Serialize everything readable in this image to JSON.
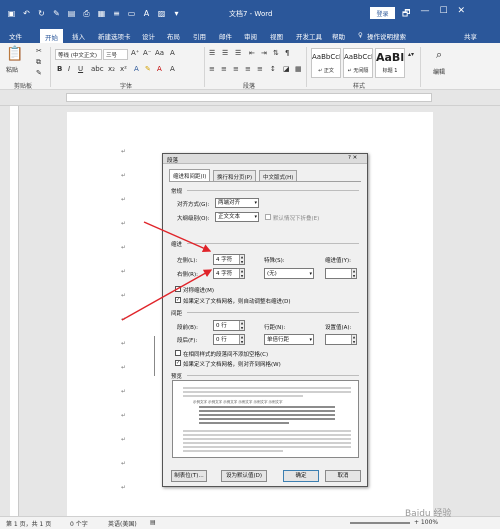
{
  "window": {
    "title": "文档7 - Word",
    "login": "登录",
    "controls": [
      "🗗",
      "—",
      "☐",
      "✕"
    ]
  },
  "tabs": [
    "文件",
    "开始",
    "插入",
    "新建选项卡",
    "设计",
    "布局",
    "引用",
    "邮件",
    "审阅",
    "视图",
    "开发工具",
    "帮助",
    "操作说明搜索",
    "共享"
  ],
  "active_tab": "开始",
  "ribbon": {
    "paste_label": "粘贴",
    "font_name": "等线 (中文正文)",
    "font_size": "三号",
    "styles": [
      {
        "preview": "AaBbCcDı",
        "name": "↵ 正文"
      },
      {
        "preview": "AaBbCcDı",
        "name": "↵ 无间隔"
      },
      {
        "preview": "AaBl",
        "name": "标题 1"
      }
    ],
    "edit_label": "编辑",
    "groups": {
      "clipboard": "剪贴板",
      "font": "字体",
      "paragraph": "段落",
      "styles": "样式"
    }
  },
  "status": {
    "page": "第 1 页，共 1 页",
    "words": "0 个字",
    "lang": "英语(美国)",
    "zoom": "+ 100%"
  },
  "dialog": {
    "title": "段落",
    "help_close": "? ✕",
    "tabs": [
      "缩进和间距(I)",
      "换行和分页(P)",
      "中文版式(H)"
    ],
    "general": {
      "title": "常规",
      "align_label": "对齐方式(G):",
      "align_value": "两端对齐",
      "outline_label": "大纲级别(O):",
      "outline_value": "正文文本",
      "collapse_label": "默认情况下折叠(E)"
    },
    "indent": {
      "title": "缩进",
      "left_label": "左侧(L):",
      "left_value": "4 字符",
      "right_label": "右侧(R):",
      "right_value": "4 字符",
      "special_label": "特殊(S):",
      "special_value": "(无)",
      "amount_label": "缩进值(Y):",
      "mirror_label": "对称缩进(M)",
      "grid_label": "如果定义了文档网格，则自动调整右缩进(D)"
    },
    "spacing": {
      "title": "间距",
      "before_label": "段前(B):",
      "before_value": "0 行",
      "after_label": "段后(F):",
      "after_value": "0 行",
      "line_label": "行距(N):",
      "line_value": "单倍行距",
      "at_label": "设置值(A):",
      "no_space_label": "在相同样式的段落间不添加空格(C)",
      "snap_label": "如果定义了文档网格，则对齐到网格(W)"
    },
    "preview_title": "预览",
    "preview_sample": "示例文字 示例文字 示例文字 示例文字 示例文字 示例文字",
    "buttons": {
      "tabs": "制表位(T)...",
      "default": "设为默认值(D)",
      "ok": "确定",
      "cancel": "取消"
    }
  },
  "watermark": "Baidu 经验",
  "colors": {
    "brand": "#2b579a",
    "arrow": "#e0242a"
  }
}
